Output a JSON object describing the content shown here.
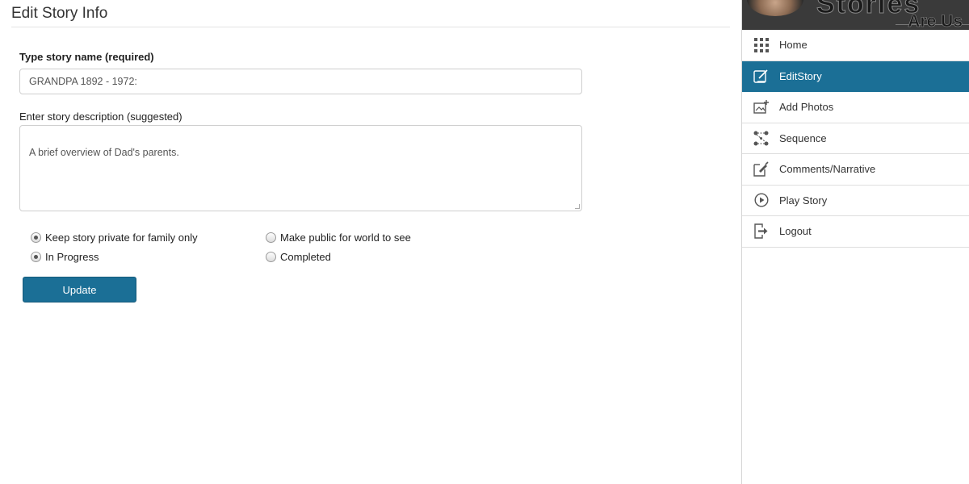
{
  "page": {
    "title": "Edit Story Info"
  },
  "form": {
    "name_label": "Type story name (required)",
    "name_value": "GRANDPA 1892 - 1972:",
    "description_label": "Enter story description (suggested)",
    "description_value": "A brief overview of Dad's parents.",
    "visibility_options": [
      {
        "label": "Keep story private for family only",
        "checked": true
      },
      {
        "label": "Make public for world to see",
        "checked": false
      }
    ],
    "status_options": [
      {
        "label": "In Progress",
        "checked": true
      },
      {
        "label": "Completed",
        "checked": false
      }
    ],
    "submit_label": "Update"
  },
  "sidebar": {
    "banner": {
      "text_top": "Stories",
      "text_bottom": "Are Us"
    },
    "items": [
      {
        "label": "Home",
        "icon": "grid-icon",
        "active": false
      },
      {
        "label": "EditStory",
        "icon": "edit-icon",
        "active": true
      },
      {
        "label": "Add Photos",
        "icon": "add-photo-icon",
        "active": false
      },
      {
        "label": "Sequence",
        "icon": "sequence-icon",
        "active": false
      },
      {
        "label": "Comments/Narrative",
        "icon": "note-pin-icon",
        "active": false
      },
      {
        "label": "Play Story",
        "icon": "play-icon",
        "active": false
      },
      {
        "label": "Logout",
        "icon": "logout-icon",
        "active": false
      }
    ]
  },
  "colors": {
    "accent": "#1b6f96",
    "banner_bg": "#3a3a3a"
  }
}
